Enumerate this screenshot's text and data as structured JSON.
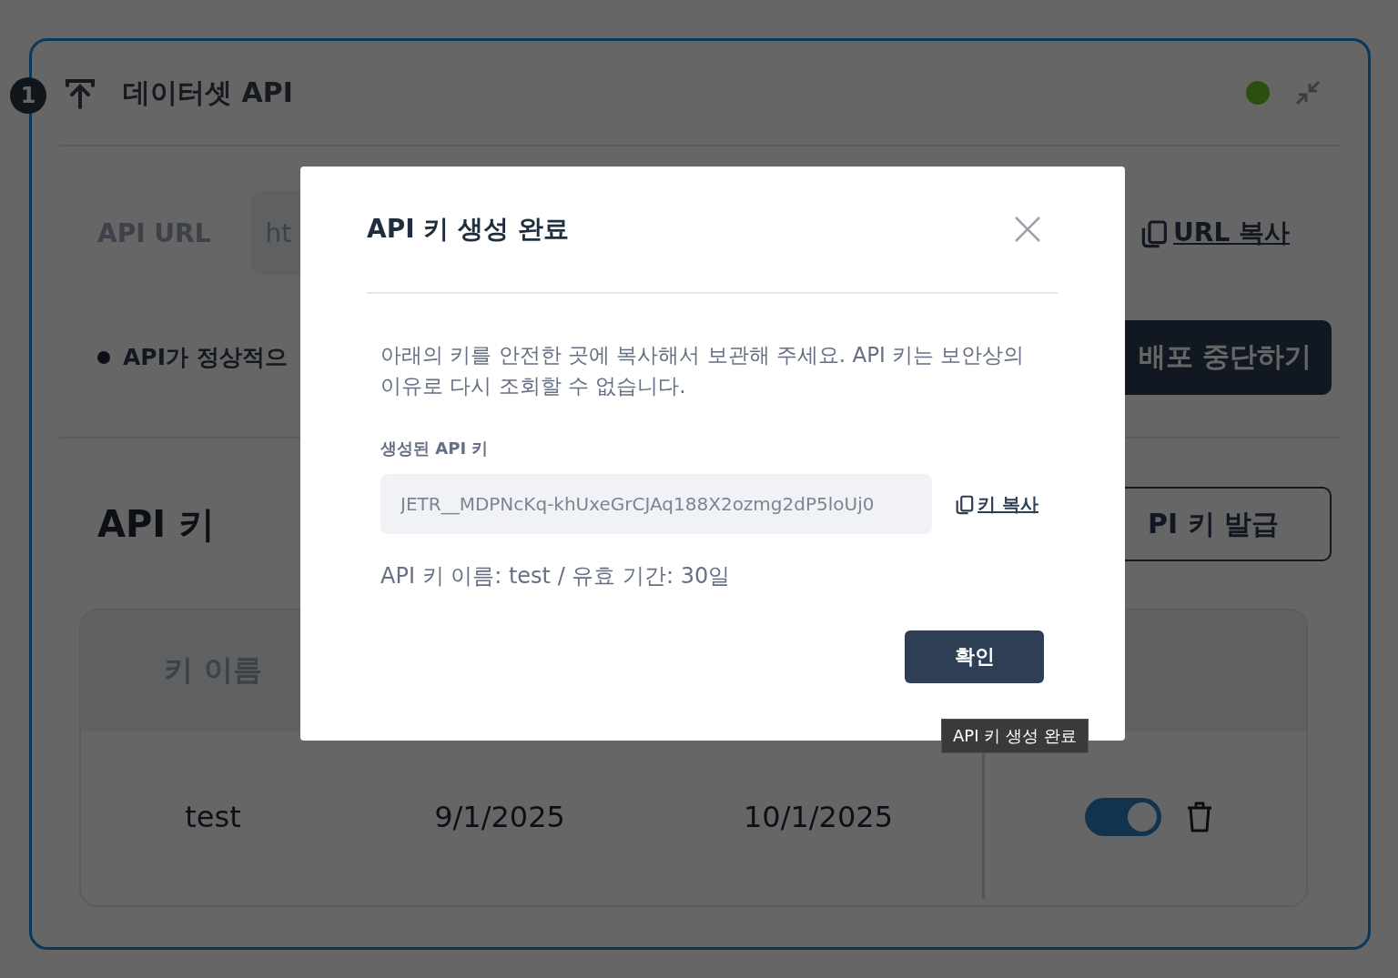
{
  "step_badge": "1",
  "panel": {
    "title": "데이터셋 API",
    "online": true
  },
  "api_url": {
    "label": "API URL",
    "value": "ht",
    "copy_link": "URL 복사"
  },
  "deploy": {
    "status_text": "API가 정상적으",
    "stop_button": "배포 중단하기"
  },
  "api_keys": {
    "heading": "API 키",
    "issue_button": "PI 키 발급",
    "columns": [
      "키 이름"
    ],
    "rows": [
      {
        "cells": [
          "test",
          "9/1/2025",
          "10/1/2025"
        ],
        "enabled": true
      }
    ]
  },
  "modal": {
    "title": "API 키 생성 완료",
    "description": "아래의 키를 안전한 곳에 복사해서 보관해 주세요. API 키는 보안상의 이유로 다시 조회할 수 없습니다.",
    "key_label": "생성된 API 키",
    "key_value": "JETR__MDPNcKq-khUxeGrCJAq188X2ozmg2dP5loUj0",
    "copy_link": "키 복사",
    "info": "API 키 이름: test / 유효 기간: 30일",
    "confirm_button": "확인"
  },
  "tooltip": "API 키 생성 완료"
}
